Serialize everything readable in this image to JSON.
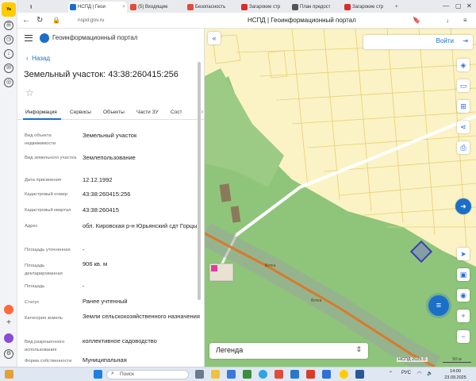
{
  "browser": {
    "tabs": [
      {
        "title": "НСПД | Геои",
        "color": "#1b6fc9",
        "active": true
      },
      {
        "title": "(5) Входящие",
        "color": "#e34b3b",
        "active": false
      },
      {
        "title": "Безопасность",
        "color": "#e34b3b",
        "active": false
      },
      {
        "title": "Загарокие стр",
        "color": "#d92c2c",
        "active": false
      },
      {
        "title": "План предост",
        "color": "#555555",
        "active": false
      },
      {
        "title": "Загарокие стр",
        "color": "#d92c2c",
        "active": false
      }
    ],
    "url": "nspd.gov.ru",
    "page_title": "НСПД | Геоинформационный портал"
  },
  "yandex": {
    "logo": "Yandex"
  },
  "panel": {
    "portal_title": "Геоинформационный портал",
    "back": "Назад",
    "heading": "Земельный участок: 43:38:260415:256",
    "tabs": [
      "Информация",
      "Сервисы",
      "Объекты",
      "Части ЗУ",
      "Сост"
    ],
    "rows": [
      {
        "label": "Вид объекта недвижимости",
        "value": "Земельный участок"
      },
      {
        "label": "Вид земельного участка",
        "value": "Землепользование"
      },
      {
        "label": "Дата присвоения",
        "value": "12.12.1992"
      },
      {
        "label": "Кадастровый номер",
        "value": "43:38:260415:256"
      },
      {
        "label": "Кадастровый квартал",
        "value": "43:38:260415"
      },
      {
        "label": "Адрес",
        "value": "обл. Кировская р-н Юрьянский сдт Горцы"
      },
      {
        "label": "Площадь уточненная",
        "value": "-"
      },
      {
        "label": "Площадь декларированная",
        "value": "906 кв. м"
      },
      {
        "label": "Площадь",
        "value": "-"
      },
      {
        "label": "Статус",
        "value": "Ранее учтенный"
      },
      {
        "label": "Категория земель",
        "value": "Земли сельскохозяйственного назначения"
      },
      {
        "label": "Вид разрешенного использования",
        "value": "коллективное садоводство"
      },
      {
        "label": "Форма собственности",
        "value": "Муниципальная"
      }
    ]
  },
  "map": {
    "login": "Войти",
    "legend": "Легенда",
    "copyright": "НСПД 2025 ©",
    "scale": "50 м",
    "road_label": "Вятка"
  },
  "taskbar": {
    "search": "Поиск",
    "lang": "РУС",
    "time": "14:00",
    "date": "23.09.2025"
  }
}
